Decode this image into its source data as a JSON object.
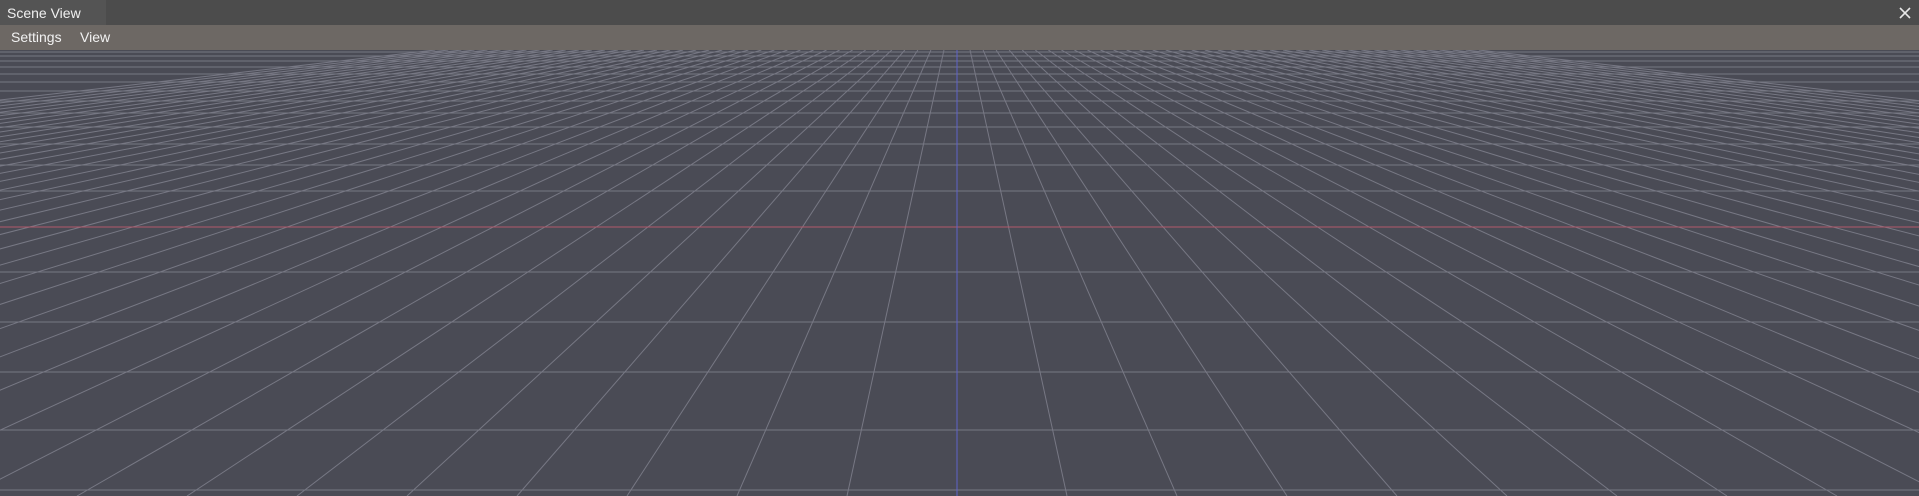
{
  "window": {
    "tab_title": "Scene View",
    "close_icon": "close-icon"
  },
  "menu": {
    "items": [
      {
        "label": "Settings"
      },
      {
        "label": "View"
      }
    ]
  },
  "viewport": {
    "grid_color": "#777884",
    "x_axis_color": "#b35a6c",
    "z_axis_color": "#5f63c9",
    "background": "#4a4b55"
  }
}
